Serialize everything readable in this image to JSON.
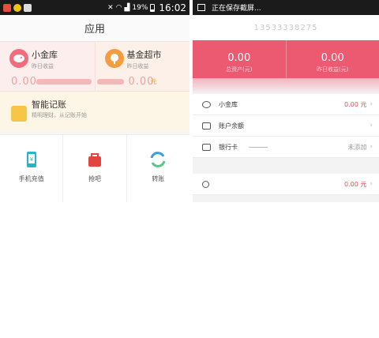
{
  "left": {
    "status_bar": {
      "battery": "19%",
      "time": "16:02"
    },
    "title": "应用",
    "cards": [
      {
        "title": "小金库",
        "subtitle": "昨日收益",
        "value": "0.00",
        "unit": ""
      },
      {
        "title": "基金超市",
        "subtitle": "昨日收益",
        "value": "0.00",
        "unit": "元"
      }
    ],
    "ledger": {
      "title": "智能记账",
      "subtitle": "精明理财，从记账开始"
    },
    "tools": [
      {
        "label": "手机充值",
        "icon": "phone-recharge-icon",
        "color": "#27b3c9"
      },
      {
        "label": "抢吧",
        "icon": "shopping-bag-icon",
        "color": "#e2453f"
      },
      {
        "label": "转账",
        "icon": "transfer-icon",
        "color": "#3aa0e0"
      }
    ]
  },
  "right": {
    "status_text": "正在保存截屏...",
    "phone_number": "13533338275",
    "totals": [
      {
        "value": "0.00",
        "label": "总资产(元)"
      },
      {
        "value": "0.00",
        "label": "昨日收益(元)"
      }
    ],
    "rows": [
      {
        "label": "小金库",
        "value": "0.00 元",
        "icon": "vault-icon"
      },
      {
        "label": "账户余额",
        "value": "",
        "icon": "wallet-icon"
      },
      {
        "label": "银行卡",
        "value": "未添加",
        "icon": "bank-card-icon"
      }
    ],
    "bottom_row": {
      "value": "0.00 元"
    }
  },
  "colors": {
    "accent": "#ec5a71",
    "pink_card": "#fdeeee",
    "value_red": "#d9534f"
  }
}
